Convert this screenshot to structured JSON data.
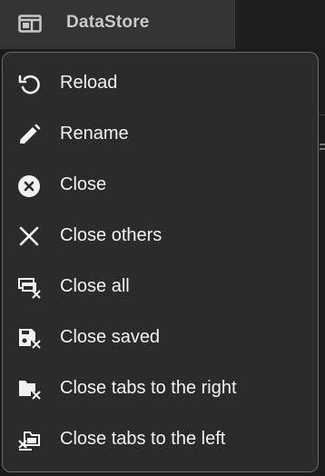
{
  "tab": {
    "title": "DataStore",
    "icon": "layout-panel-icon"
  },
  "menu": {
    "items": [
      {
        "label": "Reload",
        "icon": "reload-icon"
      },
      {
        "label": "Rename",
        "icon": "pencil-icon"
      },
      {
        "label": "Close",
        "icon": "close-circle-icon"
      },
      {
        "label": "Close others",
        "icon": "close-x-icon"
      },
      {
        "label": "Close all",
        "icon": "close-all-windows-icon"
      },
      {
        "label": "Close saved",
        "icon": "close-saved-icon"
      },
      {
        "label": "Close tabs to the right",
        "icon": "close-tabs-right-icon"
      },
      {
        "label": "Close tabs to the left",
        "icon": "close-tabs-left-icon"
      }
    ]
  },
  "colors": {
    "menu_bg": "#2b2b2b",
    "menu_border": "#6a6a6a",
    "tab_bg": "#333333",
    "text": "#f2f2f2"
  }
}
